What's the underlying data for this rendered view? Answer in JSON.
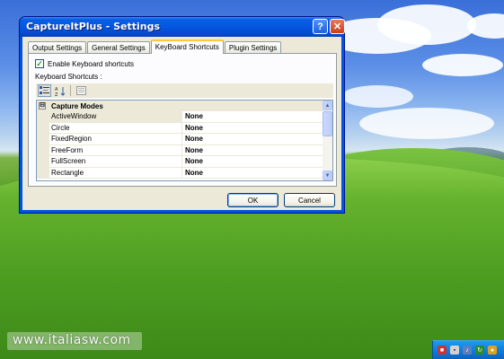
{
  "window": {
    "title": "CaptureItPlus - Settings",
    "help_label": "?",
    "close_label": "✕"
  },
  "tabs": [
    {
      "label": "Output Settings",
      "active": false
    },
    {
      "label": "General Settings",
      "active": false
    },
    {
      "label": "KeyBoard Shortcuts",
      "active": true
    },
    {
      "label": "Plugin Settings",
      "active": false
    }
  ],
  "shortcuts_tab": {
    "enable_checkbox": {
      "label": "Enable Keyboard shortcuts",
      "checked": true
    },
    "section_label": "Keyboard Shortcuts :",
    "toolbar_icons": [
      "categorized-icon",
      "alphabetical-icon",
      "property-pages-icon"
    ],
    "category": {
      "expander": "⊟",
      "label": "Capture Modes"
    },
    "rows": [
      {
        "name": "ActiveWindow",
        "value": "None",
        "selected": true
      },
      {
        "name": "Circle",
        "value": "None"
      },
      {
        "name": "FixedRegion",
        "value": "None"
      },
      {
        "name": "FreeForm",
        "value": "None"
      },
      {
        "name": "FullScreen",
        "value": "None"
      },
      {
        "name": "Rectangle",
        "value": "None"
      }
    ]
  },
  "buttons": {
    "ok_label": "OK",
    "cancel_label": "Cancel"
  },
  "watermark": "www.italiasw.com",
  "tray_icons": [
    "security-shield-icon",
    "network-icon",
    "speaker-icon",
    "update-icon",
    "app-icon"
  ],
  "colors": {
    "titlebar_blue": "#0556e0",
    "tab_highlight": "#ffc83c",
    "dialog_face": "#ece9d8"
  }
}
